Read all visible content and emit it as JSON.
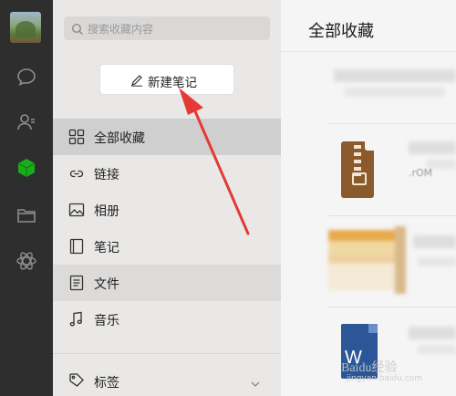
{
  "sidebar": {
    "icons": [
      "avatar",
      "chat-icon",
      "contacts-icon",
      "favorites-cube-icon",
      "folder-icon",
      "mini-program-icon"
    ],
    "active_color": "#1aad19"
  },
  "middle": {
    "search_placeholder": "搜索收藏内容",
    "new_note_label": "新建笔记",
    "nav": [
      {
        "label": "全部收藏",
        "icon": "grid-icon"
      },
      {
        "label": "链接",
        "icon": "link-icon"
      },
      {
        "label": "相册",
        "icon": "image-icon"
      },
      {
        "label": "笔记",
        "icon": "note-icon"
      },
      {
        "label": "文件",
        "icon": "file-icon"
      },
      {
        "label": "音乐",
        "icon": "music-icon"
      }
    ],
    "tags_label": "标签"
  },
  "right": {
    "title": "全部收藏",
    "file_ext": ".rOM",
    "word_letter": "W",
    "watermark": "Baidu经验",
    "watermark_url": "jingyan.baidu.com"
  },
  "annotation": {
    "color": "#e53935"
  }
}
